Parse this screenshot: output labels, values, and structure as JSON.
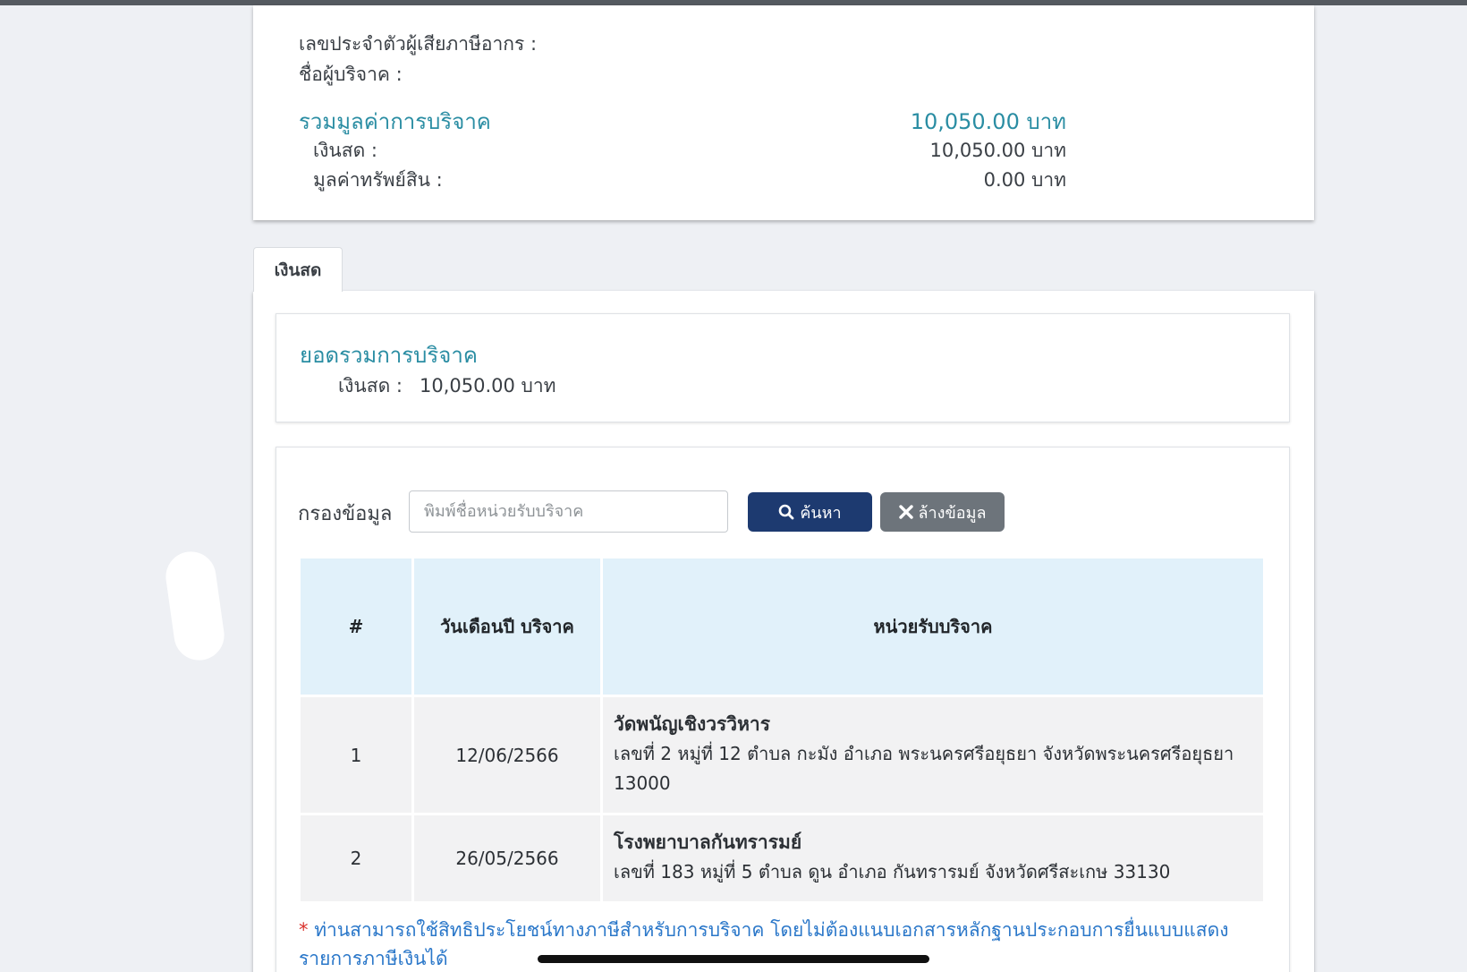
{
  "summary": {
    "tax_id_label": "เลขประจำตัวผู้เสียภาษีอากร :",
    "donor_name_label": "ชื่อผู้บริจาค :",
    "total_label": "รวมมูลค่าการบริจาค",
    "total_value": "10,050.00 บาท",
    "cash_label": "เงินสด :",
    "cash_value": "10,050.00 บาท",
    "asset_label": "มูลค่าทรัพย์สิน :",
    "asset_value": "0.00 บาท"
  },
  "tabs": [
    {
      "label": "เงินสด",
      "active": true
    }
  ],
  "total_box": {
    "title": "ยอดรวมการบริจาค",
    "cash_label": "เงินสด :",
    "cash_value": "10,050.00 บาท"
  },
  "filter": {
    "label": "กรองข้อมูล",
    "placeholder": "พิมพ์ชื่อหน่วยรับบริจาค",
    "value": "",
    "search_label": "ค้นหา",
    "search_icon": "search-icon",
    "clear_label": "ล้างข้อมูล",
    "clear_icon": "close-icon"
  },
  "table": {
    "headers": [
      "#",
      "วันเดือนปี บริจาค",
      "หน่วยรับบริจาค"
    ],
    "rows": [
      {
        "no": "1",
        "date": "12/06/2566",
        "org_name": "วัดพนัญเชิงวรวิหาร",
        "org_address": "เลขที่ 2 หมู่ที่ 12 ตำบล กะมัง อำเภอ พระนครศรีอยุธยา จังหวัดพระนครศรีอยุธยา 13000"
      },
      {
        "no": "2",
        "date": "26/05/2566",
        "org_name": "โรงพยาบาลกันทรารมย์",
        "org_address": "เลขที่ 183 หมู่ที่ 5 ตำบล ดูน อำเภอ กันทรารมย์ จังหวัดศรีสะเกษ 33130"
      }
    ]
  },
  "note": {
    "star": "*",
    "text": "ท่านสามารถใช้สิทธิประโยชน์ทางภาษีสำหรับการบริจาค โดยไม่ต้องแนบเอกสารหลักฐานประกอบการยื่นแบบแสดงรายการภาษีเงินได้"
  },
  "colors": {
    "accent_teal": "#2a8da3",
    "primary_button": "#1d3a70",
    "secondary_button": "#6d747b",
    "table_header": "#e1f1fa",
    "note_text": "#2a77c9"
  }
}
